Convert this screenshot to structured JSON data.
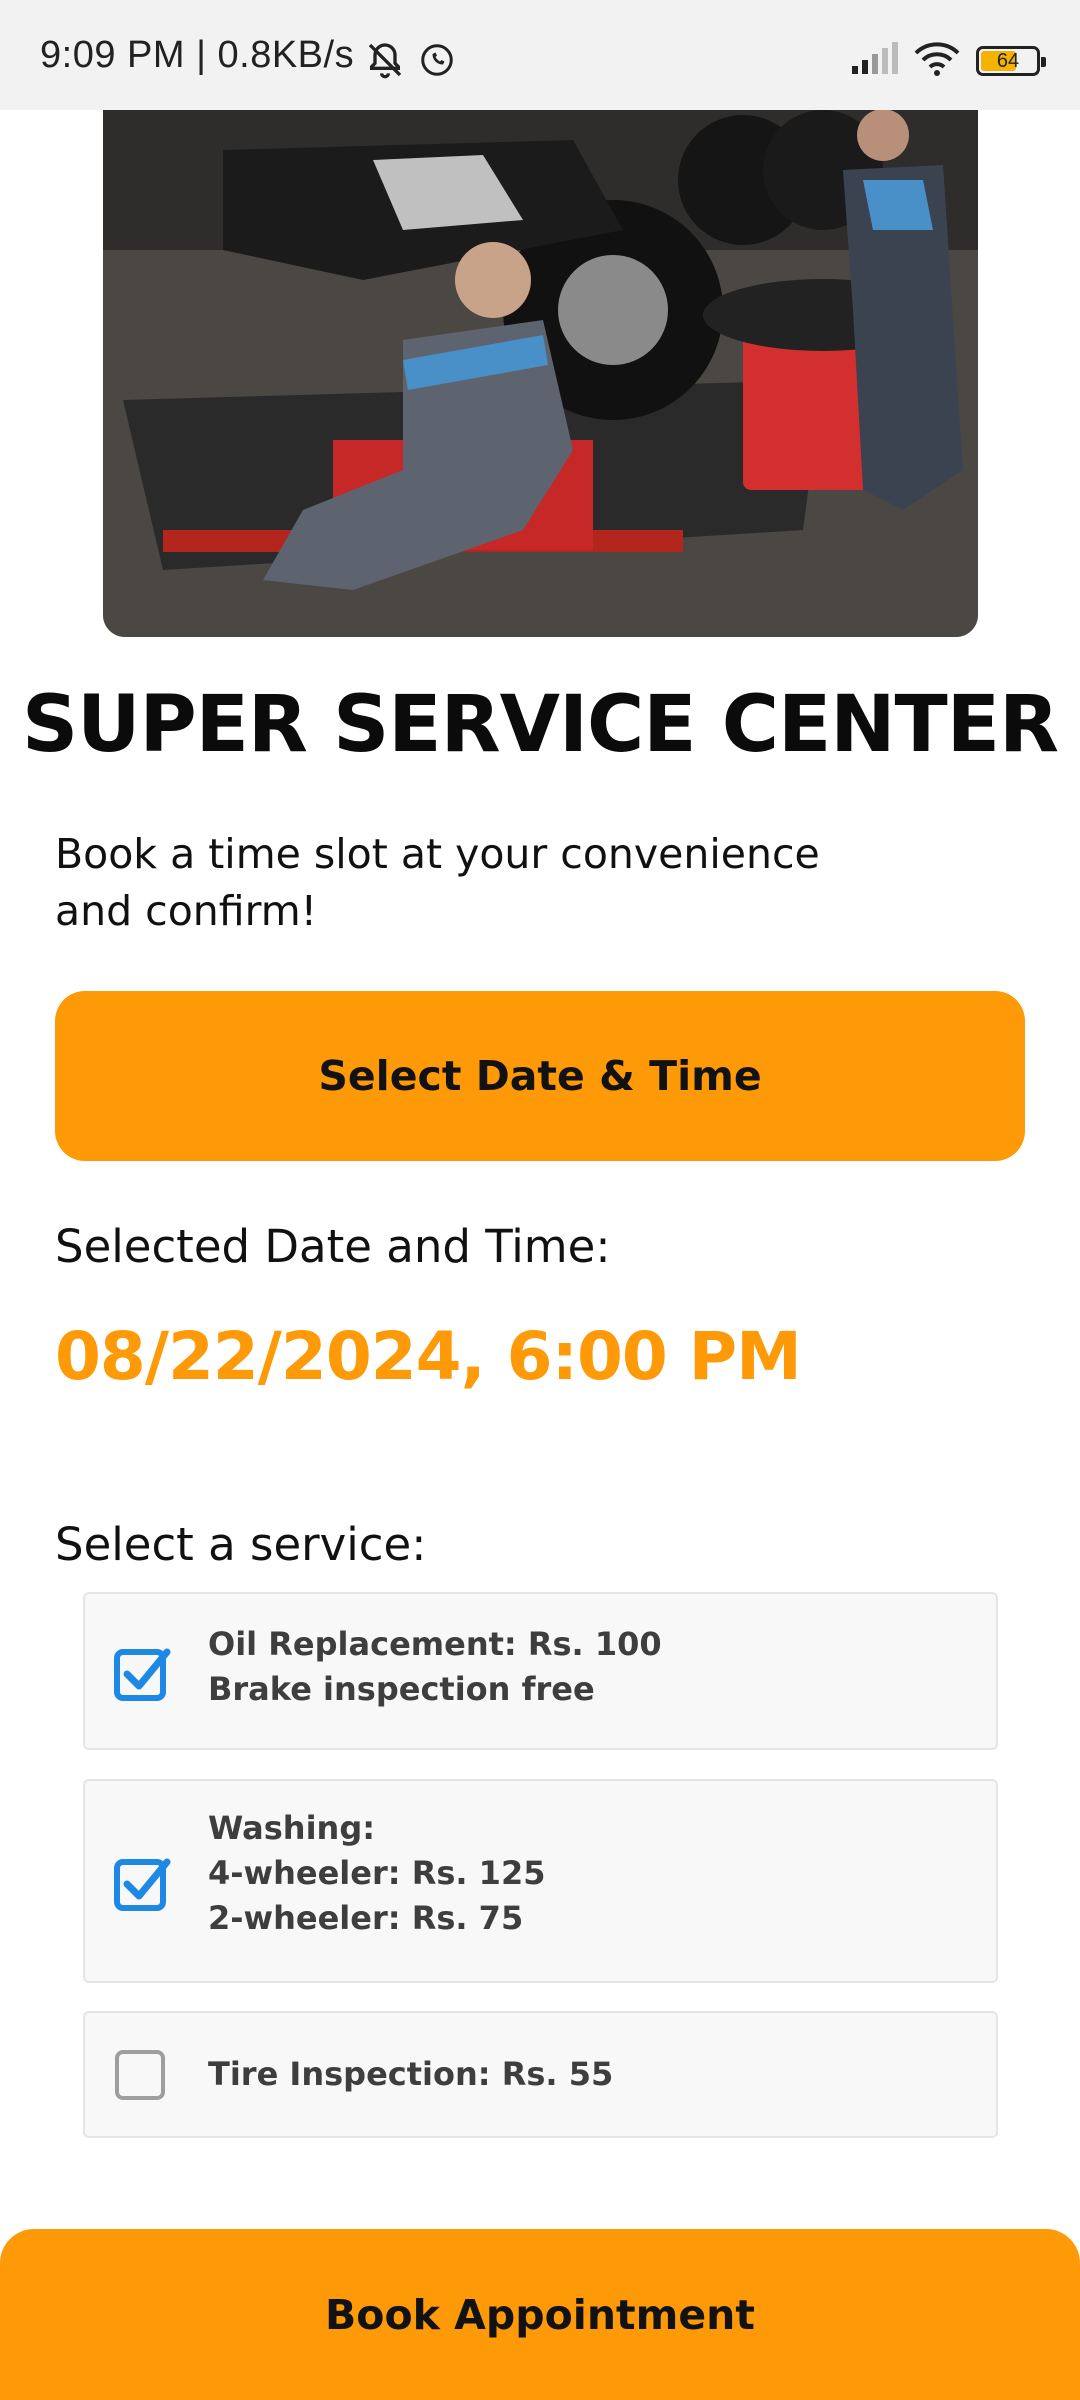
{
  "status_bar": {
    "time": "9:09 PM | 0.8KB/s",
    "battery": "64"
  },
  "title": "SUPER SERVICE CENTER",
  "subtitle": "Book a time slot at your convenience and confirm!",
  "select_button": "Select Date & Time",
  "selected_label": "Selected Date and Time:",
  "selected_value": "08/22/2024, 6:00 PM",
  "service_label": "Select a service:",
  "services": [
    {
      "lines": [
        "Oil Replacement: Rs. 100",
        "Brake inspection free"
      ],
      "checked": true
    },
    {
      "lines": [
        "Washing:",
        "4-wheeler: Rs. 125",
        "2-wheeler: Rs. 75"
      ],
      "checked": true
    },
    {
      "lines": [
        "Tire Inspection: Rs. 55"
      ],
      "checked": false
    }
  ],
  "book_button": "Book Appointment",
  "colors": {
    "accent": "#fe9a07",
    "checkbox": "#1e88e5"
  }
}
